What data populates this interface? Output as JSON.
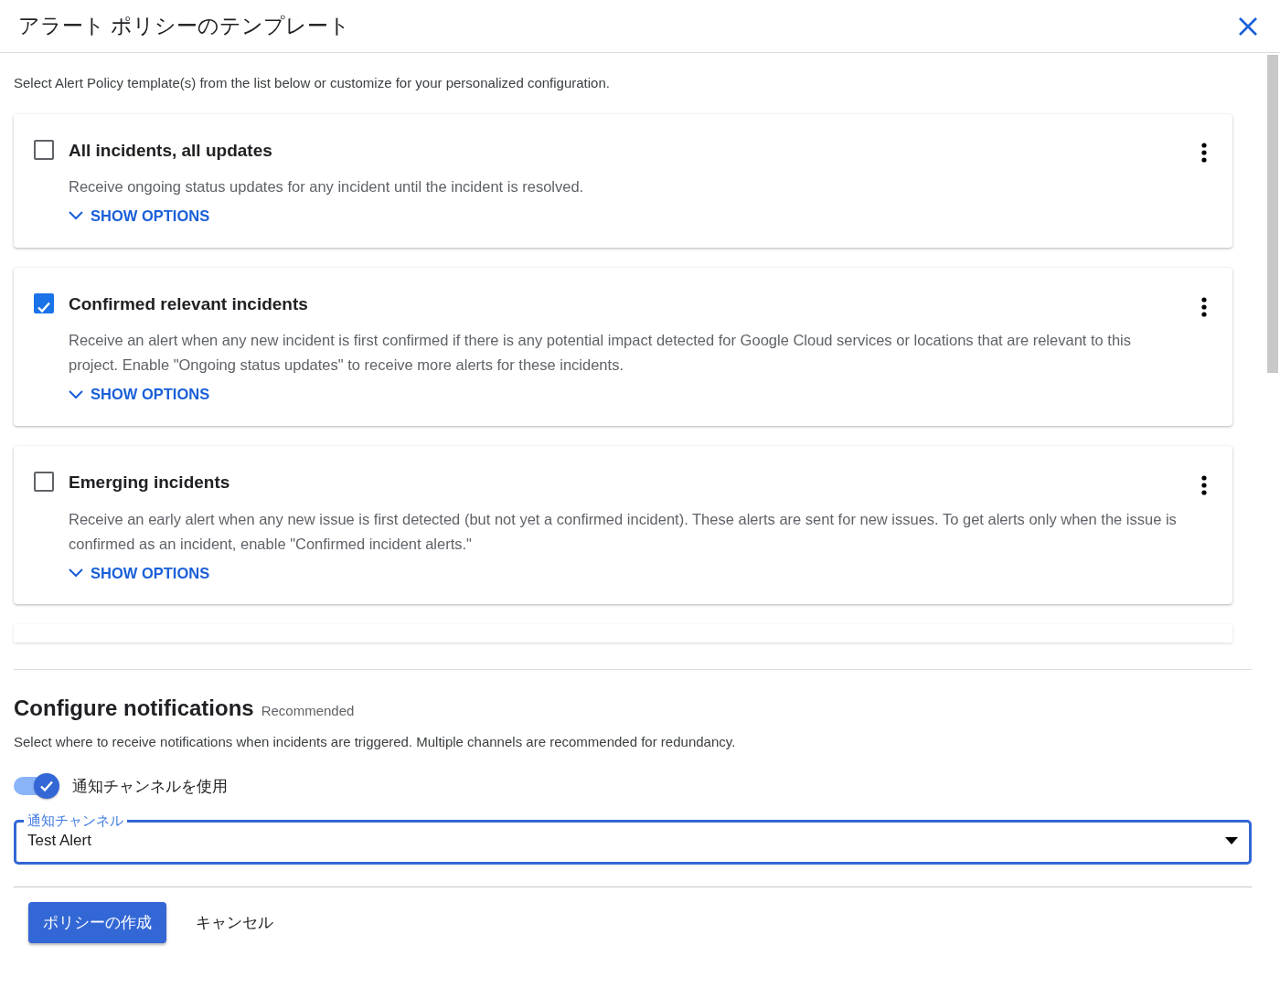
{
  "dialog": {
    "title": "アラート ポリシーのテンプレート",
    "intro": "Select Alert Policy template(s) from the list below or customize for your personalized configuration."
  },
  "templates": [
    {
      "title": "All incidents, all updates",
      "checked": false,
      "description": "Receive ongoing status updates for any incident until the incident is resolved.",
      "toggle": "SHOW OPTIONS"
    },
    {
      "title": "Confirmed relevant incidents",
      "checked": true,
      "description": "Receive an alert when any new incident is first confirmed if there is any potential impact detected for Google Cloud services or locations that are relevant to this project. Enable \"Ongoing status updates\" to receive more alerts for these incidents.",
      "toggle": "SHOW OPTIONS"
    },
    {
      "title": "Emerging incidents",
      "checked": false,
      "description": "Receive an early alert when any new issue is first detected (but not yet a confirmed incident). These alerts are sent for new issues. To get alerts only when the issue is confirmed as an incident, enable \"Confirmed incident alerts.\"",
      "toggle": "SHOW OPTIONS"
    }
  ],
  "notifications": {
    "heading": "Configure notifications",
    "tag": "Recommended",
    "description": "Select where to receive notifications when incidents are triggered. Multiple channels are recommended for redundancy.",
    "switch_label": "通知チャンネルを使用",
    "switch_on": true,
    "channel_label": "通知チャンネル",
    "channel_value": "Test Alert"
  },
  "buttons": [
    {
      "label": "ポリシーの作成",
      "kind": "primary"
    },
    {
      "label": "キャンセル",
      "kind": "text"
    }
  ]
}
